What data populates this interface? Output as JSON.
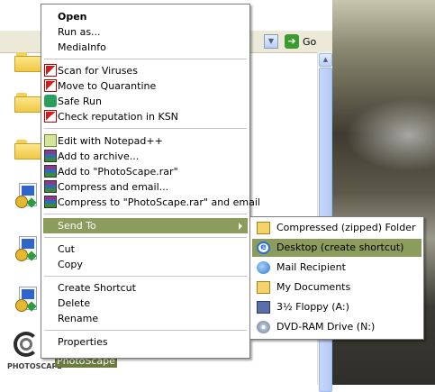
{
  "addressbar": {
    "go_label": "Go"
  },
  "selected_file": {
    "label": "PhotoScape",
    "logo_text": "PHOTOSCAPE"
  },
  "context_menu": {
    "items": [
      {
        "label": "Open",
        "bold": true
      },
      {
        "label": "Run as..."
      },
      {
        "label": "MediaInfo"
      },
      {
        "label": "Scan for Viruses",
        "icon": "kaspersky-icon"
      },
      {
        "label": "Move to Quarantine",
        "icon": "kaspersky-icon"
      },
      {
        "label": "Safe Run",
        "icon": "safe-run-icon"
      },
      {
        "label": "Check reputation in KSN",
        "icon": "kaspersky-icon"
      },
      {
        "label": "Edit with Notepad++",
        "icon": "notepad-plus-icon"
      },
      {
        "label": "Add to archive...",
        "icon": "winrar-icon"
      },
      {
        "label": "Add to \"PhotoScape.rar\"",
        "icon": "winrar-icon"
      },
      {
        "label": "Compress and email...",
        "icon": "winrar-icon"
      },
      {
        "label": "Compress to \"PhotoScape.rar\" and email",
        "icon": "winrar-icon"
      },
      {
        "label": "Send To",
        "highlighted": true,
        "submenu": true
      },
      {
        "label": "Cut"
      },
      {
        "label": "Copy"
      },
      {
        "label": "Create Shortcut"
      },
      {
        "label": "Delete"
      },
      {
        "label": "Rename"
      },
      {
        "label": "Properties"
      }
    ]
  },
  "send_to_menu": {
    "items": [
      {
        "label": "Compressed (zipped) Folder",
        "icon": "zip-folder-icon"
      },
      {
        "label": "Desktop (create shortcut)",
        "icon": "desktop-shortcut-icon",
        "highlighted": true
      },
      {
        "label": "Mail Recipient",
        "icon": "mail-recipient-icon"
      },
      {
        "label": "My Documents",
        "icon": "my-documents-icon"
      },
      {
        "label": "3½ Floppy (A:)",
        "icon": "floppy-drive-icon"
      },
      {
        "label": "DVD-RAM Drive (N:)",
        "icon": "dvd-drive-icon"
      }
    ]
  },
  "colors": {
    "menu_highlight": "#8b9c5c",
    "selection": "#6b7d3d"
  }
}
